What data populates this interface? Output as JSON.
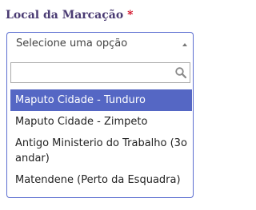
{
  "field": {
    "label": "Local da Marcação",
    "required_marker": "*"
  },
  "select": {
    "selected_text": "Selecione uma opção"
  },
  "search": {
    "value": "",
    "placeholder": ""
  },
  "options": [
    {
      "label": "Maputo Cidade - Tunduro",
      "highlighted": true
    },
    {
      "label": "Maputo Cidade - Zimpeto",
      "highlighted": false
    },
    {
      "label": "Antigo Ministerio do Trabalho (3o andar)",
      "highlighted": false
    },
    {
      "label": "Matendene (Perto da Esquadra)",
      "highlighted": false
    }
  ],
  "colors": {
    "label": "#4a3b73",
    "required": "#d0021b",
    "focus_border": "#5b6ed0",
    "highlight": "#5567c4"
  },
  "icons": {
    "search": "search-icon",
    "caret": "caret-up-icon"
  }
}
